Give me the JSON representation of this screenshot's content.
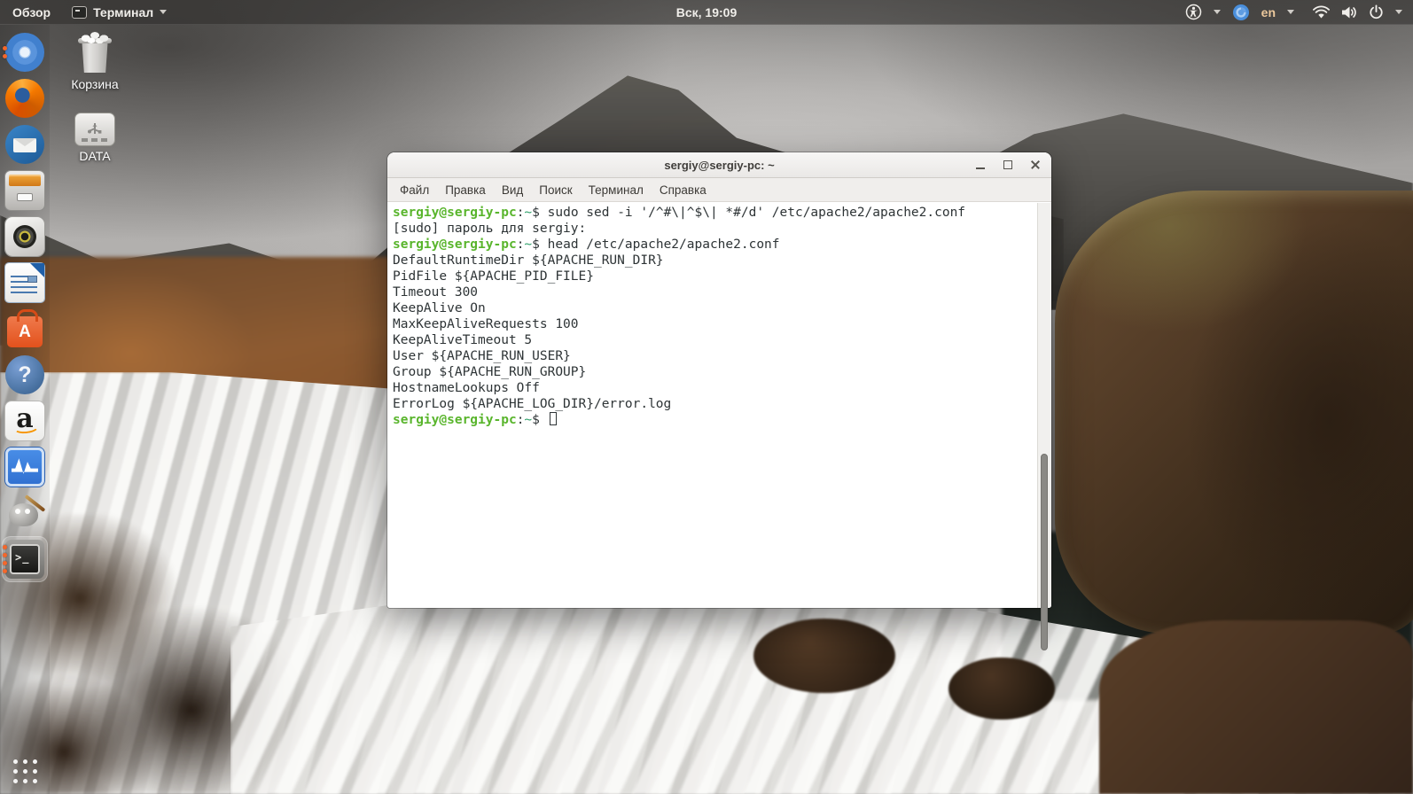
{
  "top_bar": {
    "activities_label": "Обзор",
    "app_menu_label": "Терминал",
    "clock": "Вск, 19:09",
    "language": "en"
  },
  "desktop": {
    "trash_label": "Корзина",
    "data_label": "DATA"
  },
  "dock": {
    "items": [
      {
        "id": "chromium",
        "dots": 2,
        "active": false
      },
      {
        "id": "firefox",
        "dots": 0,
        "active": false
      },
      {
        "id": "thunderbird",
        "dots": 0,
        "active": false
      },
      {
        "id": "files",
        "dots": 0,
        "active": false
      },
      {
        "id": "rhythmbox",
        "dots": 0,
        "active": false
      },
      {
        "id": "writer",
        "dots": 0,
        "active": false
      },
      {
        "id": "software",
        "dots": 0,
        "active": false
      },
      {
        "id": "help",
        "dots": 0,
        "active": false
      },
      {
        "id": "amazon",
        "dots": 0,
        "active": false
      },
      {
        "id": "sysmon",
        "dots": 0,
        "active": false
      },
      {
        "id": "gimp",
        "dots": 0,
        "active": false
      },
      {
        "id": "terminal",
        "dots": 4,
        "active": true
      }
    ]
  },
  "window": {
    "title": "sergiy@sergiy-pc: ~",
    "menu_items": [
      "Файл",
      "Правка",
      "Вид",
      "Поиск",
      "Терминал",
      "Справка"
    ],
    "terminal": {
      "prompt": {
        "user": "sergiy@sergiy-pc",
        "colon": ":",
        "path": "~",
        "dollar": "$"
      },
      "lines": [
        {
          "prompt": true,
          "command": "sudo sed -i '/^#\\|^$\\| *#/d' /etc/apache2/apache2.conf"
        },
        {
          "text": "[sudo] пароль для sergiy:"
        },
        {
          "prompt": true,
          "command": "head /etc/apache2/apache2.conf"
        },
        {
          "text": "DefaultRuntimeDir ${APACHE_RUN_DIR}"
        },
        {
          "text": "PidFile ${APACHE_PID_FILE}"
        },
        {
          "text": "Timeout 300"
        },
        {
          "text": "KeepAlive On"
        },
        {
          "text": "MaxKeepAliveRequests 100"
        },
        {
          "text": "KeepAliveTimeout 5"
        },
        {
          "text": "User ${APACHE_RUN_USER}"
        },
        {
          "text": "Group ${APACHE_RUN_GROUP}"
        },
        {
          "text": "HostnameLookups Off"
        },
        {
          "text": "ErrorLog ${APACHE_LOG_DIR}/error.log"
        },
        {
          "prompt": true,
          "command": "",
          "cursor": true
        }
      ]
    }
  },
  "colors": {
    "prompt_user": "#59b52c",
    "prompt_path": "#2fa06a",
    "terminal_fg": "#2e3436",
    "terminal_bg": "#ffffff",
    "running_dot": "#f4672b"
  }
}
